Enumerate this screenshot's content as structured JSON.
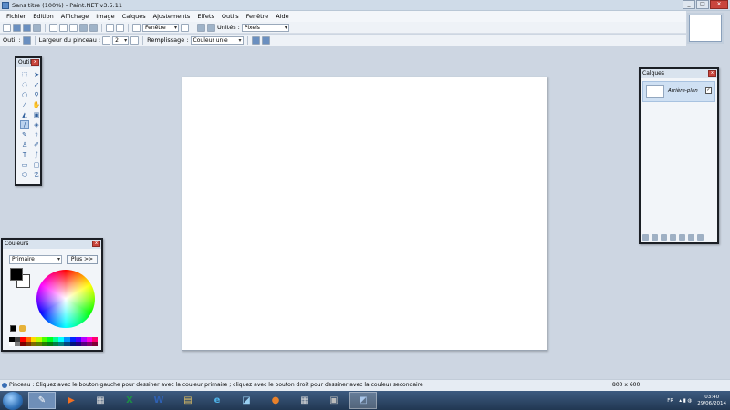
{
  "window": {
    "title": "Sans titre (100%) - Paint.NET v3.5.11"
  },
  "menu": [
    "Fichier",
    "Edition",
    "Affichage",
    "Image",
    "Calques",
    "Ajustements",
    "Effets",
    "Outils",
    "Fenêtre",
    "Aide"
  ],
  "toolbar1": {
    "zoom_value": "Fenêtre",
    "units_label": "Unités :",
    "units_value": "Pixels"
  },
  "toolbar2": {
    "tool_label": "Outil :",
    "brush_width_label": "Largeur du pinceau :",
    "brush_width_value": "2",
    "fill_label": "Remplissage :",
    "fill_value": "Couleur unie"
  },
  "tools_window": {
    "title": "Outils"
  },
  "colors_window": {
    "title": "Couleurs",
    "mode_value": "Primaire",
    "more_button": "Plus >>",
    "primary_color": "#000000",
    "secondary_color": "#ffffff"
  },
  "layers_window": {
    "title": "Calques",
    "layer_name": "Arrière-plan",
    "layer_visible": "✓"
  },
  "status": {
    "message": "Pinceau : Cliquez avec le bouton gauche pour dessiner avec la couleur primaire ; cliquez avec le bouton droit pour dessiner avec la couleur secondaire",
    "image_size": "800 x 600"
  },
  "taskbar": {
    "lang": "FR",
    "time": "03:40",
    "date": "29/06/2014"
  }
}
